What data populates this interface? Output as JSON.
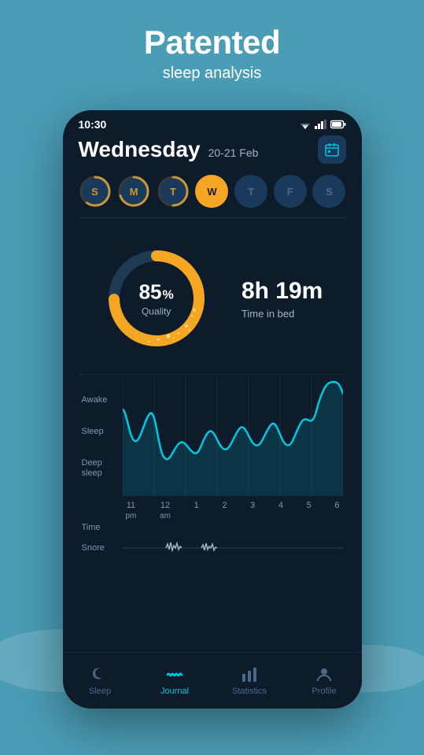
{
  "header": {
    "title": "Patented",
    "subtitle": "sleep analysis"
  },
  "statusBar": {
    "time": "10:30"
  },
  "dayHeader": {
    "dayName": "Wednesday",
    "dateRange": "20-21 Feb"
  },
  "weekDays": [
    {
      "label": "S",
      "state": "data",
      "fillPercent": 0.6
    },
    {
      "label": "M",
      "state": "data",
      "fillPercent": 0.7
    },
    {
      "label": "T",
      "state": "data",
      "fillPercent": 0.5
    },
    {
      "label": "W",
      "state": "active"
    },
    {
      "label": "T",
      "state": "inactive"
    },
    {
      "label": "F",
      "state": "inactive"
    },
    {
      "label": "S",
      "state": "inactive"
    }
  ],
  "sleepQuality": {
    "percent": "85",
    "percentSuffix": "%",
    "label": "Quality"
  },
  "timeInBed": {
    "value": "8h 19m",
    "label": "Time in bed"
  },
  "chartLabels": {
    "yLabels": [
      "Awake",
      "Sleep",
      "Deep\nsleep"
    ],
    "xLabels": [
      {
        "line1": "11",
        "line2": "pm"
      },
      {
        "line1": "12",
        "line2": "am"
      },
      {
        "line1": "1",
        "line2": ""
      },
      {
        "line1": "2",
        "line2": ""
      },
      {
        "line1": "3",
        "line2": ""
      },
      {
        "line1": "4",
        "line2": ""
      },
      {
        "line1": "5",
        "line2": ""
      },
      {
        "line1": "6",
        "line2": ""
      }
    ],
    "timeLabel": "Time",
    "snoreLabel": "Snore"
  },
  "bottomNav": {
    "items": [
      {
        "label": "Sleep",
        "icon": "moon",
        "active": false
      },
      {
        "label": "Journal",
        "icon": "wave",
        "active": true
      },
      {
        "label": "Statistics",
        "icon": "bar-chart",
        "active": false
      },
      {
        "label": "Profile",
        "icon": "person",
        "active": false
      }
    ]
  }
}
